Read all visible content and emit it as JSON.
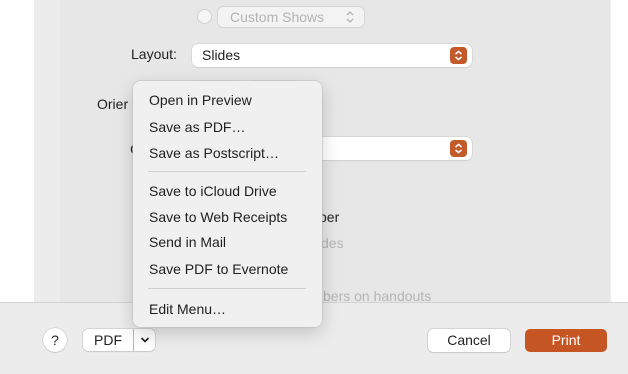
{
  "print_options": {
    "custom_shows_label": "Custom Shows",
    "layout_label": "Layout:",
    "layout_value": "Slides",
    "orientation_label_partial": "Orier",
    "second_select_label_partial": "C",
    "hidden_text_1_partial": "per",
    "hidden_text_2_partial": "des",
    "hidden_text_3_partial": "bers on handouts"
  },
  "pdf_menu": {
    "items": [
      "Open in Preview",
      "Save as PDF…",
      "Save as Postscript…",
      "Save to iCloud Drive",
      "Save to Web Receipts",
      "Send in Mail",
      "Save PDF to Evernote",
      "Edit Menu…"
    ]
  },
  "footer": {
    "help_label": "?",
    "pdf_label": "PDF",
    "cancel_label": "Cancel",
    "print_label": "Print"
  },
  "colors": {
    "accent": "#c65524"
  }
}
